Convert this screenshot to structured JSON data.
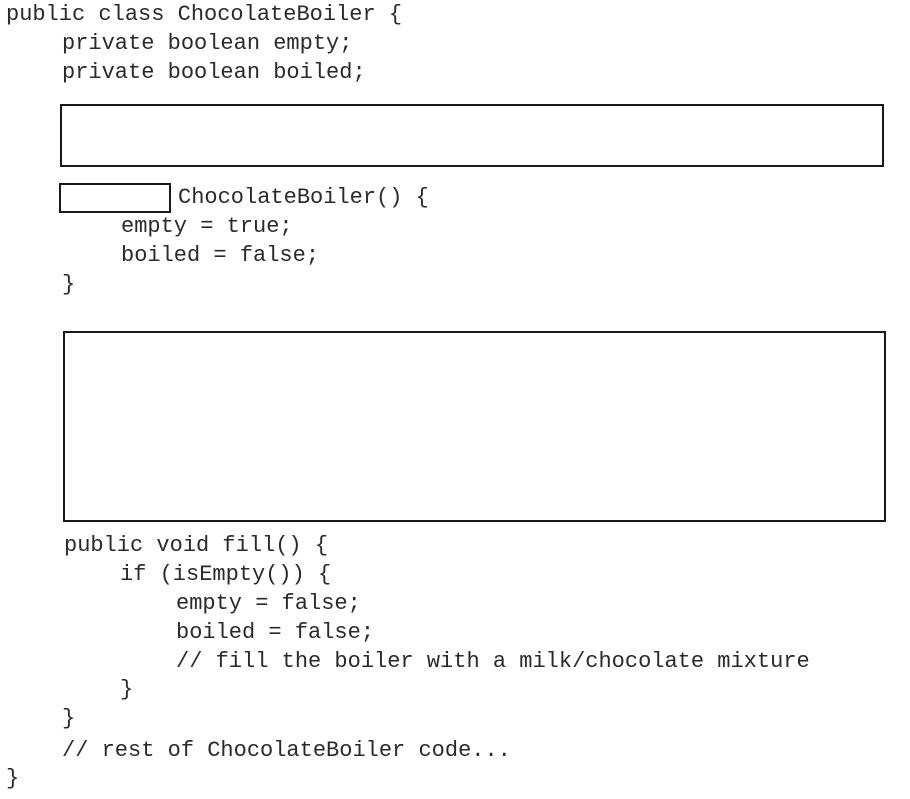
{
  "code": {
    "class_open": "public class ChocolateBoiler {",
    "field_empty": "private boolean empty;",
    "field_boiled": "private boolean boiled;",
    "constructor_signature": "ChocolateBoiler() {",
    "constructor_empty": "empty = true;",
    "constructor_boiled": "boiled = false;",
    "constructor_close": "}",
    "fill_signature": "public void fill() {",
    "fill_if": "if (isEmpty()) {",
    "fill_empty": "empty = false;",
    "fill_boiled": "boiled = false;",
    "fill_comment": "// fill the boiler with a milk/chocolate mixture",
    "fill_if_close": "}",
    "fill_close": "}",
    "rest_comment": "// rest of ChocolateBoiler code...",
    "class_close": "}"
  }
}
